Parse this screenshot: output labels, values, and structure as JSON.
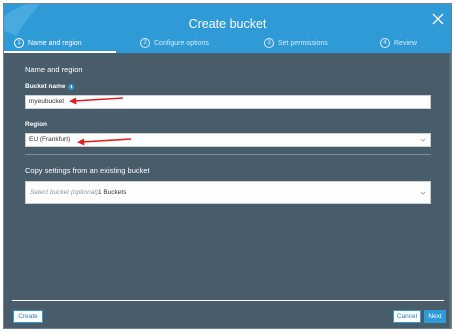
{
  "modal": {
    "title": "Create bucket",
    "close_label": "×"
  },
  "steps": [
    {
      "num": "1",
      "label": "Name and region",
      "active": true
    },
    {
      "num": "2",
      "label": "Configure options",
      "active": false
    },
    {
      "num": "3",
      "label": "Set permissions",
      "active": false
    },
    {
      "num": "4",
      "label": "Review",
      "active": false
    }
  ],
  "form": {
    "section_title": "Name and region",
    "bucket_name": {
      "label": "Bucket name",
      "value": "myeubucket"
    },
    "region": {
      "label": "Region",
      "value": "EU (Frankfurt)"
    },
    "copy_settings": {
      "title": "Copy settings from an existing bucket",
      "placeholder": "Select bucket (optional)",
      "count_text": "1 Buckets"
    }
  },
  "footer": {
    "create_label": "Create",
    "cancel_label": "Cancel",
    "next_label": "Next"
  },
  "colors": {
    "header": "#2e9ad6",
    "body": "#485c69",
    "arrow": "#e02020"
  }
}
